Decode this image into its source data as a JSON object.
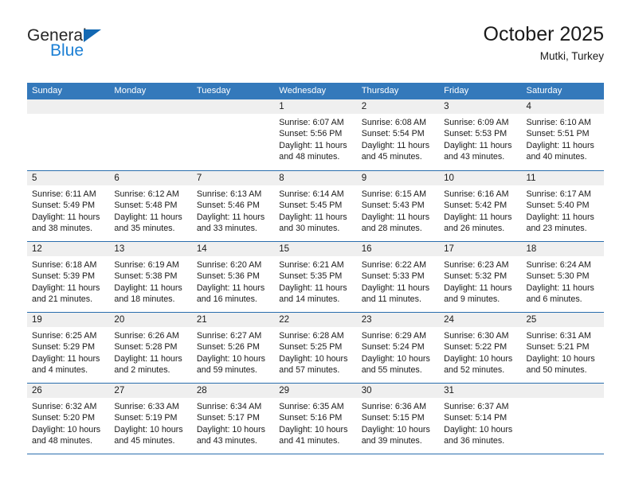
{
  "brand": {
    "name_top": "General",
    "name_bottom": "Blue",
    "triangle_color": "#1268b3",
    "blue_text_color": "#1b7fd4"
  },
  "header": {
    "title": "October 2025",
    "subtitle": "Mutki, Turkey"
  },
  "theme": {
    "header_blue": "#3479bb",
    "row_rule_blue": "#2a6ead",
    "daynum_band": "#efefef"
  },
  "weekdays": [
    "Sunday",
    "Monday",
    "Tuesday",
    "Wednesday",
    "Thursday",
    "Friday",
    "Saturday"
  ],
  "weeks": [
    [
      {
        "day": "",
        "lines": []
      },
      {
        "day": "",
        "lines": []
      },
      {
        "day": "",
        "lines": []
      },
      {
        "day": "1",
        "lines": [
          "Sunrise: 6:07 AM",
          "Sunset: 5:56 PM",
          "Daylight: 11 hours",
          "and 48 minutes."
        ]
      },
      {
        "day": "2",
        "lines": [
          "Sunrise: 6:08 AM",
          "Sunset: 5:54 PM",
          "Daylight: 11 hours",
          "and 45 minutes."
        ]
      },
      {
        "day": "3",
        "lines": [
          "Sunrise: 6:09 AM",
          "Sunset: 5:53 PM",
          "Daylight: 11 hours",
          "and 43 minutes."
        ]
      },
      {
        "day": "4",
        "lines": [
          "Sunrise: 6:10 AM",
          "Sunset: 5:51 PM",
          "Daylight: 11 hours",
          "and 40 minutes."
        ]
      }
    ],
    [
      {
        "day": "5",
        "lines": [
          "Sunrise: 6:11 AM",
          "Sunset: 5:49 PM",
          "Daylight: 11 hours",
          "and 38 minutes."
        ]
      },
      {
        "day": "6",
        "lines": [
          "Sunrise: 6:12 AM",
          "Sunset: 5:48 PM",
          "Daylight: 11 hours",
          "and 35 minutes."
        ]
      },
      {
        "day": "7",
        "lines": [
          "Sunrise: 6:13 AM",
          "Sunset: 5:46 PM",
          "Daylight: 11 hours",
          "and 33 minutes."
        ]
      },
      {
        "day": "8",
        "lines": [
          "Sunrise: 6:14 AM",
          "Sunset: 5:45 PM",
          "Daylight: 11 hours",
          "and 30 minutes."
        ]
      },
      {
        "day": "9",
        "lines": [
          "Sunrise: 6:15 AM",
          "Sunset: 5:43 PM",
          "Daylight: 11 hours",
          "and 28 minutes."
        ]
      },
      {
        "day": "10",
        "lines": [
          "Sunrise: 6:16 AM",
          "Sunset: 5:42 PM",
          "Daylight: 11 hours",
          "and 26 minutes."
        ]
      },
      {
        "day": "11",
        "lines": [
          "Sunrise: 6:17 AM",
          "Sunset: 5:40 PM",
          "Daylight: 11 hours",
          "and 23 minutes."
        ]
      }
    ],
    [
      {
        "day": "12",
        "lines": [
          "Sunrise: 6:18 AM",
          "Sunset: 5:39 PM",
          "Daylight: 11 hours",
          "and 21 minutes."
        ]
      },
      {
        "day": "13",
        "lines": [
          "Sunrise: 6:19 AM",
          "Sunset: 5:38 PM",
          "Daylight: 11 hours",
          "and 18 minutes."
        ]
      },
      {
        "day": "14",
        "lines": [
          "Sunrise: 6:20 AM",
          "Sunset: 5:36 PM",
          "Daylight: 11 hours",
          "and 16 minutes."
        ]
      },
      {
        "day": "15",
        "lines": [
          "Sunrise: 6:21 AM",
          "Sunset: 5:35 PM",
          "Daylight: 11 hours",
          "and 14 minutes."
        ]
      },
      {
        "day": "16",
        "lines": [
          "Sunrise: 6:22 AM",
          "Sunset: 5:33 PM",
          "Daylight: 11 hours",
          "and 11 minutes."
        ]
      },
      {
        "day": "17",
        "lines": [
          "Sunrise: 6:23 AM",
          "Sunset: 5:32 PM",
          "Daylight: 11 hours",
          "and 9 minutes."
        ]
      },
      {
        "day": "18",
        "lines": [
          "Sunrise: 6:24 AM",
          "Sunset: 5:30 PM",
          "Daylight: 11 hours",
          "and 6 minutes."
        ]
      }
    ],
    [
      {
        "day": "19",
        "lines": [
          "Sunrise: 6:25 AM",
          "Sunset: 5:29 PM",
          "Daylight: 11 hours",
          "and 4 minutes."
        ]
      },
      {
        "day": "20",
        "lines": [
          "Sunrise: 6:26 AM",
          "Sunset: 5:28 PM",
          "Daylight: 11 hours",
          "and 2 minutes."
        ]
      },
      {
        "day": "21",
        "lines": [
          "Sunrise: 6:27 AM",
          "Sunset: 5:26 PM",
          "Daylight: 10 hours",
          "and 59 minutes."
        ]
      },
      {
        "day": "22",
        "lines": [
          "Sunrise: 6:28 AM",
          "Sunset: 5:25 PM",
          "Daylight: 10 hours",
          "and 57 minutes."
        ]
      },
      {
        "day": "23",
        "lines": [
          "Sunrise: 6:29 AM",
          "Sunset: 5:24 PM",
          "Daylight: 10 hours",
          "and 55 minutes."
        ]
      },
      {
        "day": "24",
        "lines": [
          "Sunrise: 6:30 AM",
          "Sunset: 5:22 PM",
          "Daylight: 10 hours",
          "and 52 minutes."
        ]
      },
      {
        "day": "25",
        "lines": [
          "Sunrise: 6:31 AM",
          "Sunset: 5:21 PM",
          "Daylight: 10 hours",
          "and 50 minutes."
        ]
      }
    ],
    [
      {
        "day": "26",
        "lines": [
          "Sunrise: 6:32 AM",
          "Sunset: 5:20 PM",
          "Daylight: 10 hours",
          "and 48 minutes."
        ]
      },
      {
        "day": "27",
        "lines": [
          "Sunrise: 6:33 AM",
          "Sunset: 5:19 PM",
          "Daylight: 10 hours",
          "and 45 minutes."
        ]
      },
      {
        "day": "28",
        "lines": [
          "Sunrise: 6:34 AM",
          "Sunset: 5:17 PM",
          "Daylight: 10 hours",
          "and 43 minutes."
        ]
      },
      {
        "day": "29",
        "lines": [
          "Sunrise: 6:35 AM",
          "Sunset: 5:16 PM",
          "Daylight: 10 hours",
          "and 41 minutes."
        ]
      },
      {
        "day": "30",
        "lines": [
          "Sunrise: 6:36 AM",
          "Sunset: 5:15 PM",
          "Daylight: 10 hours",
          "and 39 minutes."
        ]
      },
      {
        "day": "31",
        "lines": [
          "Sunrise: 6:37 AM",
          "Sunset: 5:14 PM",
          "Daylight: 10 hours",
          "and 36 minutes."
        ]
      },
      {
        "day": "",
        "lines": []
      }
    ]
  ]
}
